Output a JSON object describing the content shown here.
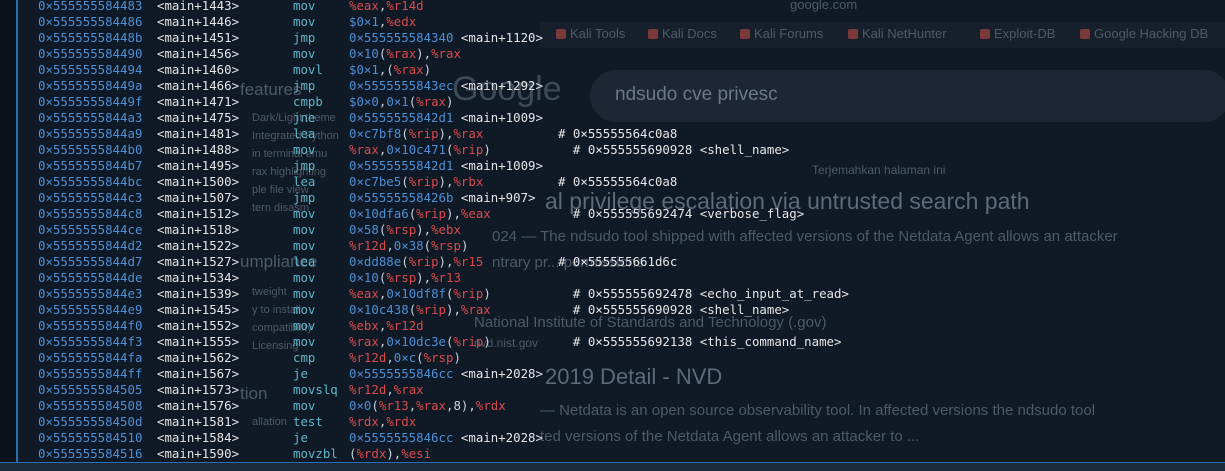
{
  "background_browser": {
    "bookmarks": [
      {
        "label": "Kali Tools"
      },
      {
        "label": "Kali Docs"
      },
      {
        "label": "Kali Forums"
      },
      {
        "label": "Kali NetHunter"
      },
      {
        "label": "Exploit-DB"
      },
      {
        "label": "Google Hacking DB"
      }
    ],
    "tab_hint": "google.com",
    "logo_text": "Google",
    "search_query": "ndsudo cve privesc",
    "result_1_title": "al privilege escalation via untrusted search path",
    "result_1_snippet_a": "024 — The ndsudo tool shipped with affected versions of the Netdata Agent allows an attacker",
    "result_1_snippet_b": "ntrary pr... permissions",
    "translate_hint": "Terjemahkan halaman ini",
    "result_2_source": "National Institute of Standards and Technology (.gov)",
    "result_2_url": "nvd.nist.gov",
    "result_2_title": "2019 Detail - NVD",
    "result_2_snippet_a": "— Netdata is an open source observability tool. In affected versions the ndsudo tool",
    "result_2_snippet_b": "ted versions of the Netdata Agent allows an attacker to ...",
    "left_col": [
      "features",
      "Dark/Light theme",
      "Integrated Python",
      "in terminal emu",
      "rax highlighting",
      "ple file view",
      "tern disasm",
      "umpliance",
      "tweight",
      "y to install",
      "compatibility",
      "Licensing",
      "tion",
      "allation"
    ]
  },
  "colors": {
    "address": "#4f8fd6",
    "symbol": "#e6e6e6",
    "mnemonic": "#5fb6c9",
    "register": "#d94b4b",
    "immediate": "#4f8fd6",
    "border_accent": "#2a6fb0"
  },
  "disassembly": [
    {
      "addr": "0×555555584483",
      "sym": "<main+1443>",
      "mnem": "mov",
      "ops": [
        [
          "reg",
          "%eax"
        ],
        [
          "plain",
          ","
        ],
        [
          "reg",
          "%r14d"
        ]
      ],
      "cmt": ""
    },
    {
      "addr": "0×555555584486",
      "sym": "<main+1446>",
      "mnem": "mov",
      "ops": [
        [
          "imm",
          "$0×1"
        ],
        [
          "plain",
          ","
        ],
        [
          "reg",
          "%edx"
        ]
      ],
      "cmt": ""
    },
    {
      "addr": "0×55555558448b",
      "sym": "<main+1451>",
      "mnem": "jmp",
      "ops": [
        [
          "imm",
          "0×555555584340"
        ],
        [
          "tgt",
          " <main+1120>"
        ]
      ],
      "cmt": ""
    },
    {
      "addr": "0×555555584490",
      "sym": "<main+1456>",
      "mnem": "mov",
      "ops": [
        [
          "imm",
          "0×10"
        ],
        [
          "plain",
          "("
        ],
        [
          "reg",
          "%rax"
        ],
        [
          "plain",
          "),"
        ],
        [
          "reg",
          "%rax"
        ]
      ],
      "cmt": ""
    },
    {
      "addr": "0×555555584494",
      "sym": "<main+1460>",
      "mnem": "movl",
      "ops": [
        [
          "imm",
          "$0×1"
        ],
        [
          "plain",
          ",("
        ],
        [
          "reg",
          "%rax"
        ],
        [
          "plain",
          ")"
        ]
      ],
      "cmt": ""
    },
    {
      "addr": "0×55555558449a",
      "sym": "<main+1466>",
      "mnem": "jmp",
      "ops": [
        [
          "imm",
          "0×5555555843ec"
        ],
        [
          "tgt",
          " <main+1292>"
        ]
      ],
      "cmt": ""
    },
    {
      "addr": "0×55555558449f",
      "sym": "<main+1471>",
      "mnem": "cmpb",
      "ops": [
        [
          "imm",
          "$0×0"
        ],
        [
          "plain",
          ","
        ],
        [
          "imm",
          "0×1"
        ],
        [
          "plain",
          "("
        ],
        [
          "reg",
          "%rax"
        ],
        [
          "plain",
          ")"
        ]
      ],
      "cmt": ""
    },
    {
      "addr": "0×5555555844a3",
      "sym": "<main+1475>",
      "mnem": "jne",
      "ops": [
        [
          "imm",
          "0×5555555842d1"
        ],
        [
          "tgt",
          " <main+1009>"
        ]
      ],
      "cmt": ""
    },
    {
      "addr": "0×5555555844a9",
      "sym": "<main+1481>",
      "mnem": "lea",
      "ops": [
        [
          "imm",
          "0×c7bf8"
        ],
        [
          "plain",
          "("
        ],
        [
          "reg",
          "%rip"
        ],
        [
          "plain",
          "),"
        ],
        [
          "reg",
          "%rax"
        ]
      ],
      "cmt": "# 0×55555564c0a8"
    },
    {
      "addr": "0×5555555844b0",
      "sym": "<main+1488>",
      "mnem": "mov",
      "ops": [
        [
          "reg",
          "%rax"
        ],
        [
          "plain",
          ","
        ],
        [
          "imm",
          "0×10c471"
        ],
        [
          "plain",
          "("
        ],
        [
          "reg",
          "%rip"
        ],
        [
          "plain",
          ")"
        ]
      ],
      "cmt": "  # 0×555555690928 <shell_name>"
    },
    {
      "addr": "0×5555555844b7",
      "sym": "<main+1495>",
      "mnem": "jmp",
      "ops": [
        [
          "imm",
          "0×5555555842d1"
        ],
        [
          "tgt",
          " <main+1009>"
        ]
      ],
      "cmt": ""
    },
    {
      "addr": "0×5555555844bc",
      "sym": "<main+1500>",
      "mnem": "lea",
      "ops": [
        [
          "imm",
          "0×c7be5"
        ],
        [
          "plain",
          "("
        ],
        [
          "reg",
          "%rip"
        ],
        [
          "plain",
          "),"
        ],
        [
          "reg",
          "%rbx"
        ]
      ],
      "cmt": "# 0×55555564c0a8"
    },
    {
      "addr": "0×5555555844c3",
      "sym": "<main+1507>",
      "mnem": "jmp",
      "ops": [
        [
          "imm",
          "0×55555558426b"
        ],
        [
          "tgt",
          " <main+907>"
        ]
      ],
      "cmt": ""
    },
    {
      "addr": "0×5555555844c8",
      "sym": "<main+1512>",
      "mnem": "mov",
      "ops": [
        [
          "imm",
          "0×10dfa6"
        ],
        [
          "plain",
          "("
        ],
        [
          "reg",
          "%rip"
        ],
        [
          "plain",
          "),"
        ],
        [
          "reg",
          "%eax"
        ]
      ],
      "cmt": "  # 0×555555692474 <verbose_flag>"
    },
    {
      "addr": "0×5555555844ce",
      "sym": "<main+1518>",
      "mnem": "mov",
      "ops": [
        [
          "imm",
          "0×58"
        ],
        [
          "plain",
          "("
        ],
        [
          "reg",
          "%rsp"
        ],
        [
          "plain",
          "),"
        ],
        [
          "reg",
          "%ebx"
        ]
      ],
      "cmt": ""
    },
    {
      "addr": "0×5555555844d2",
      "sym": "<main+1522>",
      "mnem": "mov",
      "ops": [
        [
          "reg",
          "%r12d"
        ],
        [
          "plain",
          ","
        ],
        [
          "imm",
          "0×38"
        ],
        [
          "plain",
          "("
        ],
        [
          "reg",
          "%rsp"
        ],
        [
          "plain",
          ")"
        ]
      ],
      "cmt": ""
    },
    {
      "addr": "0×5555555844d7",
      "sym": "<main+1527>",
      "mnem": "lea",
      "ops": [
        [
          "imm",
          "0×dd88e"
        ],
        [
          "plain",
          "("
        ],
        [
          "reg",
          "%rip"
        ],
        [
          "plain",
          "),"
        ],
        [
          "reg",
          "%r15"
        ]
      ],
      "cmt": "# 0×555555661d6c"
    },
    {
      "addr": "0×5555555844de",
      "sym": "<main+1534>",
      "mnem": "mov",
      "ops": [
        [
          "imm",
          "0×10"
        ],
        [
          "plain",
          "("
        ],
        [
          "reg",
          "%rsp"
        ],
        [
          "plain",
          "),"
        ],
        [
          "reg",
          "%r13"
        ]
      ],
      "cmt": ""
    },
    {
      "addr": "0×5555555844e3",
      "sym": "<main+1539>",
      "mnem": "mov",
      "ops": [
        [
          "reg",
          "%eax"
        ],
        [
          "plain",
          ","
        ],
        [
          "imm",
          "0×10df8f"
        ],
        [
          "plain",
          "("
        ],
        [
          "reg",
          "%rip"
        ],
        [
          "plain",
          ")"
        ]
      ],
      "cmt": "  # 0×555555692478 <echo_input_at_read>"
    },
    {
      "addr": "0×5555555844e9",
      "sym": "<main+1545>",
      "mnem": "mov",
      "ops": [
        [
          "imm",
          "0×10c438"
        ],
        [
          "plain",
          "("
        ],
        [
          "reg",
          "%rip"
        ],
        [
          "plain",
          "),"
        ],
        [
          "reg",
          "%rax"
        ]
      ],
      "cmt": "  # 0×555555690928 <shell_name>"
    },
    {
      "addr": "0×5555555844f0",
      "sym": "<main+1552>",
      "mnem": "mov",
      "ops": [
        [
          "reg",
          "%ebx"
        ],
        [
          "plain",
          ","
        ],
        [
          "reg",
          "%r12d"
        ]
      ],
      "cmt": ""
    },
    {
      "addr": "0×5555555844f3",
      "sym": "<main+1555>",
      "mnem": "mov",
      "ops": [
        [
          "reg",
          "%rax"
        ],
        [
          "plain",
          ","
        ],
        [
          "imm",
          "0×10dc3e"
        ],
        [
          "plain",
          "("
        ],
        [
          "reg",
          "%rip"
        ],
        [
          "plain",
          ")"
        ]
      ],
      "cmt": "  # 0×555555692138 <this_command_name>"
    },
    {
      "addr": "0×5555555844fa",
      "sym": "<main+1562>",
      "mnem": "cmp",
      "ops": [
        [
          "reg",
          "%r12d"
        ],
        [
          "plain",
          ","
        ],
        [
          "imm",
          "0×c"
        ],
        [
          "plain",
          "("
        ],
        [
          "reg",
          "%rsp"
        ],
        [
          "plain",
          ")"
        ]
      ],
      "cmt": ""
    },
    {
      "addr": "0×5555555844ff",
      "sym": "<main+1567>",
      "mnem": "je",
      "ops": [
        [
          "imm",
          "0×5555555846cc"
        ],
        [
          "tgt",
          " <main+2028>"
        ]
      ],
      "cmt": ""
    },
    {
      "addr": "0×555555584505",
      "sym": "<main+1573>",
      "mnem": "movslq",
      "ops": [
        [
          "reg",
          "%r12d"
        ],
        [
          "plain",
          ","
        ],
        [
          "reg",
          "%rax"
        ]
      ],
      "cmt": ""
    },
    {
      "addr": "0×555555584508",
      "sym": "<main+1576>",
      "mnem": "mov",
      "ops": [
        [
          "imm",
          "0×0"
        ],
        [
          "plain",
          "("
        ],
        [
          "reg",
          "%r13"
        ],
        [
          "plain",
          ","
        ],
        [
          "reg",
          "%rax"
        ],
        [
          "plain",
          ",8),"
        ],
        [
          "reg",
          "%rdx"
        ]
      ],
      "cmt": ""
    },
    {
      "addr": "0×55555558450d",
      "sym": "<main+1581>",
      "mnem": "test",
      "ops": [
        [
          "reg",
          "%rdx"
        ],
        [
          "plain",
          ","
        ],
        [
          "reg",
          "%rdx"
        ]
      ],
      "cmt": ""
    },
    {
      "addr": "0×555555584510",
      "sym": "<main+1584>",
      "mnem": "je",
      "ops": [
        [
          "imm",
          "0×5555555846cc"
        ],
        [
          "tgt",
          " <main+2028>"
        ]
      ],
      "cmt": ""
    },
    {
      "addr": "0×555555584516",
      "sym": "<main+1590>",
      "mnem": "movzbl",
      "ops": [
        [
          "plain",
          "("
        ],
        [
          "reg",
          "%rdx"
        ],
        [
          "plain",
          "),"
        ],
        [
          "reg",
          "%esi"
        ]
      ],
      "cmt": ""
    }
  ]
}
